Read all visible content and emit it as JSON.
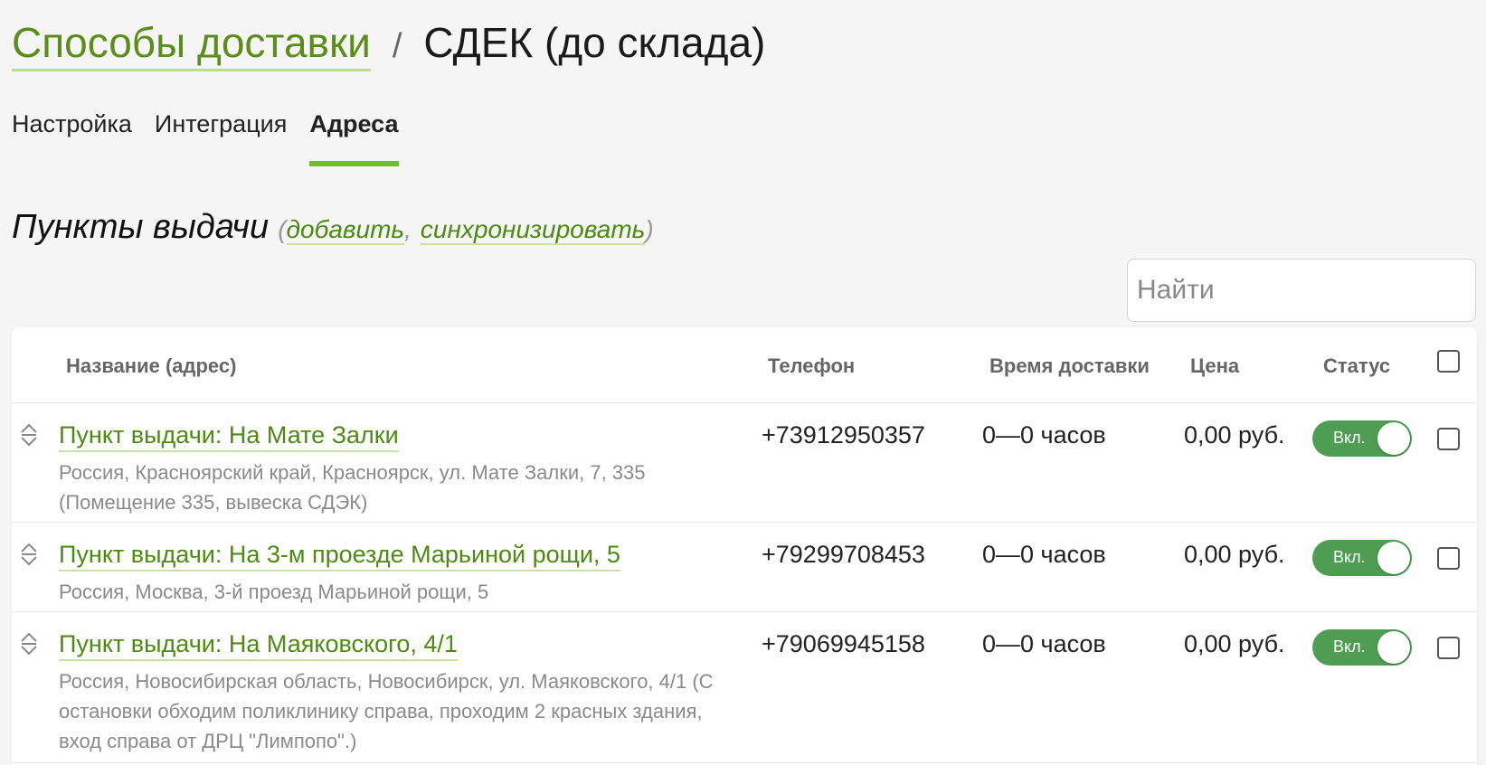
{
  "header": {
    "breadcrumb_label": "Способы доставки",
    "separator": "/",
    "title": "СДЕК (до склада)"
  },
  "tabs": [
    {
      "label": "Настройка",
      "active": false
    },
    {
      "label": "Интеграция",
      "active": false
    },
    {
      "label": "Адреса",
      "active": true
    }
  ],
  "section": {
    "title": "Пункты выдачи",
    "paren_open": "(",
    "add_link": "добавить",
    "comma": ",",
    "sync_link": "синхронизировать",
    "paren_close": ")"
  },
  "search": {
    "placeholder": "Найти",
    "value": ""
  },
  "table": {
    "columns": {
      "name": "Название (адрес)",
      "phone": "Телефон",
      "time": "Время доставки",
      "price": "Цена",
      "status": "Статус"
    },
    "rows": [
      {
        "name": "Пункт выдачи: На Мате Залки",
        "address": "Россия, Красноярский край, Красноярск, ул. Мате Залки, 7, 335 (Помещение 335, вывеска СДЭК)",
        "phone": "+73912950357",
        "time": "0—0 часов",
        "price": "0,00 руб.",
        "status": "Вкл."
      },
      {
        "name": "Пункт выдачи: На 3-м проезде Марьиной рощи, 5",
        "address": "Россия, Москва, 3-й проезд Марьиной рощи, 5",
        "phone": "+79299708453",
        "time": "0—0 часов",
        "price": "0,00 руб.",
        "status": "Вкл."
      },
      {
        "name": "Пункт выдачи: На Маяковского, 4/1",
        "address": "Россия, Новосибирская область, Новосибирск, ул. Маяковского, 4/1 (С остановки обходим поликлинику справа, проходим 2 красных здания, вход справа от ДРЦ \"Лимпопо\".)",
        "phone": "+79069945158",
        "time": "0—0 часов",
        "price": "0,00 руб.",
        "status": "Вкл."
      }
    ]
  },
  "colors": {
    "link": "#4d8a12",
    "tab_underline": "#6fbf2a",
    "toggle_on": "#4f9d52"
  }
}
